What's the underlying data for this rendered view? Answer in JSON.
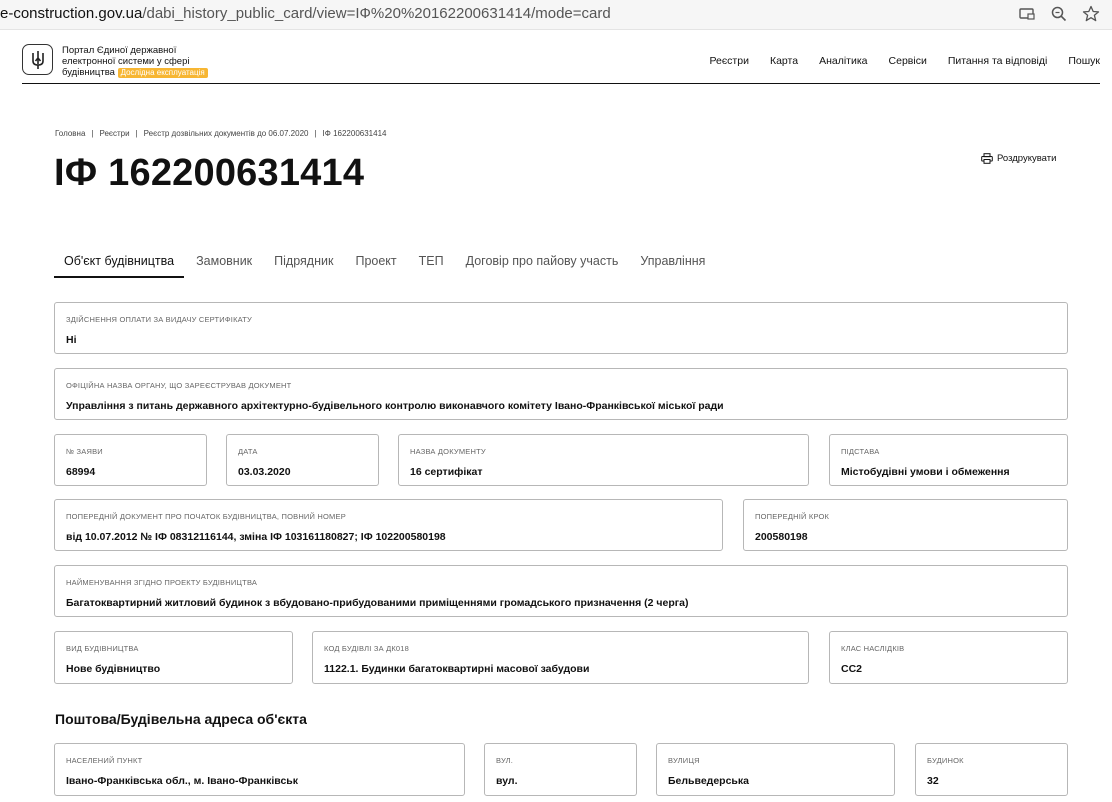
{
  "browser": {
    "url_host": "e-construction.gov.ua",
    "url_path": "/dabi_history_public_card/view=IФ%20%20162200631414/mode=card"
  },
  "header": {
    "logo_line1": "Портал Єдиної державної",
    "logo_line2": "електронної системи у сфері",
    "logo_line3": "будівництва",
    "beta_badge": "Дослідна експлуатація",
    "nav": [
      "Реєстри",
      "Карта",
      "Аналітика",
      "Сервіси",
      "Питання та відповіді",
      "Пошук"
    ]
  },
  "breadcrumb": [
    "Головна",
    "Реєстри",
    "Реєстр дозвільних документів до 06.07.2020",
    "IФ 162200631414"
  ],
  "page": {
    "title": "IФ 162200631414",
    "print_label": "Роздрукувати"
  },
  "tabs": [
    "Об'єкт будівництва",
    "Замовник",
    "Підрядник",
    "Проект",
    "ТЕП",
    "Договір про пайову участь",
    "Управління"
  ],
  "fields": {
    "payment": {
      "label": "Здійснення оплати за видачу сертифікату",
      "value": "Ні"
    },
    "authority": {
      "label": "Офіційна назва органу, що зареєстрував документ",
      "value": "Управління з питань державного архітектурно-будівельного контролю виконавчого комітету Івано-Франківської міської ради"
    },
    "app_no": {
      "label": "№ заяви",
      "value": "68994"
    },
    "date": {
      "label": "Дата",
      "value": "03.03.2020"
    },
    "doc_name": {
      "label": "Назва документу",
      "value": "16 сертифікат"
    },
    "basis": {
      "label": "Підстава",
      "value": "Містобудівні умови і обмеження"
    },
    "prev_doc": {
      "label": "Попередній документ про початок будівництва, повний номер",
      "value": "від 10.07.2012 № IФ 08312116144, зміна IФ 103161180827; IФ 102200580198"
    },
    "prev_step": {
      "label": "Попередній крок",
      "value": "200580198"
    },
    "project_name": {
      "label": "Найменування згідно проекту будівництва",
      "value": "Багатоквартирний житловий будинок з вбудовано-прибудованими приміщеннями громадського призначення (2 черга)"
    },
    "build_type": {
      "label": "Вид будівництва",
      "value": "Нове будівництво"
    },
    "dk_code": {
      "label": "Код будівлі за ДК018",
      "value": "1122.1. Будинки багатоквартирні масової забудови"
    },
    "cc_class": {
      "label": "Клас наслідків",
      "value": "СС2"
    }
  },
  "address": {
    "section_title": "Поштова/Будівельна адреса об'єкта",
    "locality": {
      "label": "Населений пункт",
      "value": "Івано-Франківська обл., м. Івано-Франківськ"
    },
    "street_type": {
      "label": "Вул.",
      "value": "вул."
    },
    "street": {
      "label": "Вулиця",
      "value": "Бельведерська"
    },
    "house": {
      "label": "Будинок",
      "value": "32"
    }
  }
}
